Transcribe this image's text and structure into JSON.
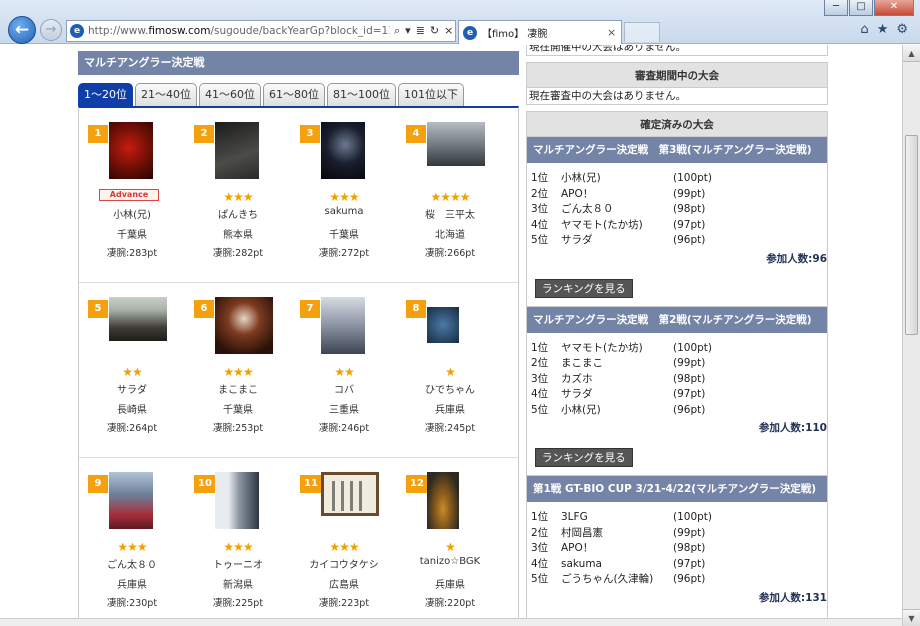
{
  "browser": {
    "url_prefix": "http://www.",
    "url_domain": "fimosw.com",
    "url_rest": "/sugoude/backYearGp?block_id=1148&y",
    "tab_title": "【fimo】 凄腕",
    "tab_close": "×",
    "search_glyph": "⌕",
    "dropdown_glyph": "▾",
    "compat_glyph": "≣",
    "refresh_glyph": "↻",
    "stop_glyph": "×",
    "home_glyph": "⌂",
    "fav_glyph": "★",
    "settings_glyph": "⚙",
    "ie_letter": "e",
    "back_glyph": "←",
    "fwd_glyph": "→",
    "minimize_glyph": "─",
    "maximize_glyph": "□",
    "close_glyph": "✕"
  },
  "ranking": {
    "header": "マルチアングラー決定戦",
    "tabs": [
      "1〜20位",
      "21〜40位",
      "41〜60位",
      "61〜80位",
      "81〜100位",
      "101位以下"
    ],
    "rows": [
      [
        {
          "rank": "1",
          "name": "小林(兄)",
          "pref": "千葉県",
          "score": "凄腕:283pt",
          "stars": "",
          "badge": "Advance",
          "photo": "ph-red"
        },
        {
          "rank": "2",
          "name": "ぱんきち",
          "pref": "熊本県",
          "score": "凄腕:282pt",
          "stars": "★★★",
          "badge": "",
          "photo": "ph-dark"
        },
        {
          "rank": "3",
          "name": "sakuma",
          "pref": "千葉県",
          "score": "凄腕:272pt",
          "stars": "★★★",
          "badge": "",
          "photo": "ph-night"
        },
        {
          "rank": "4",
          "name": "桜　三平太",
          "pref": "北海道",
          "score": "凄腕:266pt",
          "stars": "★★★★",
          "badge": "",
          "photo": "ph-grey"
        }
      ],
      [
        {
          "rank": "5",
          "name": "サラダ",
          "pref": "長崎県",
          "score": "凄腕:264pt",
          "stars": "★★",
          "badge": "",
          "photo": "ph-shore"
        },
        {
          "rank": "6",
          "name": "まこまこ",
          "pref": "千葉県",
          "score": "凄腕:253pt",
          "stars": "★★★",
          "badge": "",
          "photo": "ph-mask"
        },
        {
          "rank": "7",
          "name": "コバ",
          "pref": "三重県",
          "score": "凄腕:246pt",
          "stars": "★★",
          "badge": "",
          "photo": "ph-pale"
        },
        {
          "rank": "8",
          "name": "ひでちゃん",
          "pref": "兵庫県",
          "score": "凄腕:245pt",
          "stars": "★",
          "badge": "",
          "photo": "ph-small"
        }
      ],
      [
        {
          "rank": "9",
          "name": "ごん太８０",
          "pref": "兵庫県",
          "score": "凄腕:230pt",
          "stars": "★★★",
          "badge": "",
          "photo": "ph-lady"
        },
        {
          "rank": "10",
          "name": "トゥーニオ",
          "pref": "新潟県",
          "score": "凄腕:225pt",
          "stars": "★★★",
          "badge": "",
          "photo": "ph-fish"
        },
        {
          "rank": "11",
          "name": "カイコウタケシ",
          "pref": "広島県",
          "score": "凄腕:223pt",
          "stars": "★★★",
          "badge": "",
          "photo": "ph-callig"
        },
        {
          "rank": "12",
          "name": "tanizo☆BGK",
          "pref": "兵庫県",
          "score": "凄腕:220pt",
          "stars": "★",
          "badge": "",
          "photo": "ph-flat"
        }
      ]
    ]
  },
  "sidebar": {
    "held_none": "現在開催中の大会はありません。",
    "review_head": "審査期間中の大会",
    "review_none": "現在審査中の大会はありません。",
    "confirmed_head": "確定済みの大会",
    "button_label": "ランキングを見る",
    "tournaments": [
      {
        "title": "マルチアングラー決定戦　第3戦(マルチアングラー決定戦)",
        "results": [
          {
            "pos": "1位",
            "name": "小林(兄)",
            "pt": "(100pt)"
          },
          {
            "pos": "2位",
            "name": "APO！",
            "pt": "(99pt)"
          },
          {
            "pos": "3位",
            "name": "ごん太８０",
            "pt": "(98pt)"
          },
          {
            "pos": "4位",
            "name": "ヤマモト(たか坊)",
            "pt": "(97pt)"
          },
          {
            "pos": "5位",
            "name": "サラダ",
            "pt": "(96pt)"
          }
        ],
        "count": "参加人数:96"
      },
      {
        "title": "マルチアングラー決定戦　第2戦(マルチアングラー決定戦)",
        "results": [
          {
            "pos": "1位",
            "name": "ヤマモト(たか坊)",
            "pt": "(100pt)"
          },
          {
            "pos": "2位",
            "name": "まこまこ",
            "pt": "(99pt)"
          },
          {
            "pos": "3位",
            "name": "カズホ",
            "pt": "(98pt)"
          },
          {
            "pos": "4位",
            "name": "サラダ",
            "pt": "(97pt)"
          },
          {
            "pos": "5位",
            "name": "小林(兄)",
            "pt": "(96pt)"
          }
        ],
        "count": "参加人数:110"
      },
      {
        "title": "第1戦 GT-BIO CUP 3/21-4/22(マルチアングラー決定戦)",
        "results": [
          {
            "pos": "1位",
            "name": "3LFG",
            "pt": "(100pt)"
          },
          {
            "pos": "2位",
            "name": "村岡昌憲",
            "pt": "(99pt)"
          },
          {
            "pos": "3位",
            "name": "APO！",
            "pt": "(98pt)"
          },
          {
            "pos": "4位",
            "name": "sakuma",
            "pt": "(97pt)"
          },
          {
            "pos": "5位",
            "name": "ごうちゃん(久津輪)",
            "pt": "(96pt)"
          }
        ],
        "count": "参加人数:131"
      }
    ]
  }
}
